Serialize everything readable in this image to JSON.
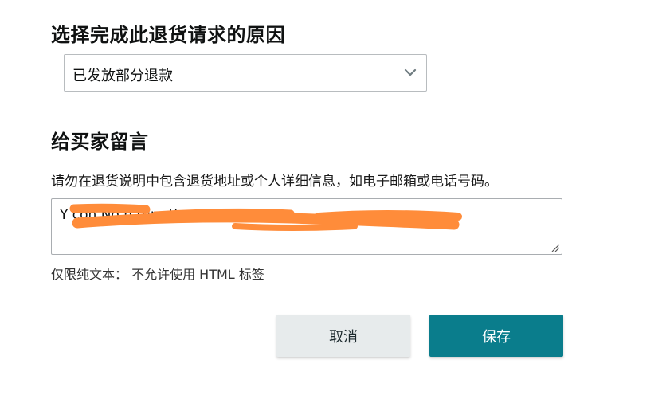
{
  "reason_section": {
    "title": "选择完成此退货请求的原因",
    "selected_reason": "已发放部分退款"
  },
  "message_section": {
    "title": "给买家留言",
    "instruction": "请勿在退货说明中包含退货地址或个人详细信息，如电子邮箱或电话号码。",
    "textarea_value": "Y        con        No n         turn the ite",
    "hint": "仅限纯文本： 不允许使用 HTML 标签"
  },
  "actions": {
    "cancel_label": "取消",
    "save_label": "保存"
  },
  "colors": {
    "primary": "#0a7d8c",
    "secondary": "#e7ebec",
    "redaction": "#ff8c3a"
  },
  "icons": {
    "dropdown": "chevron-down-icon",
    "resize": "resize-handle-icon"
  }
}
